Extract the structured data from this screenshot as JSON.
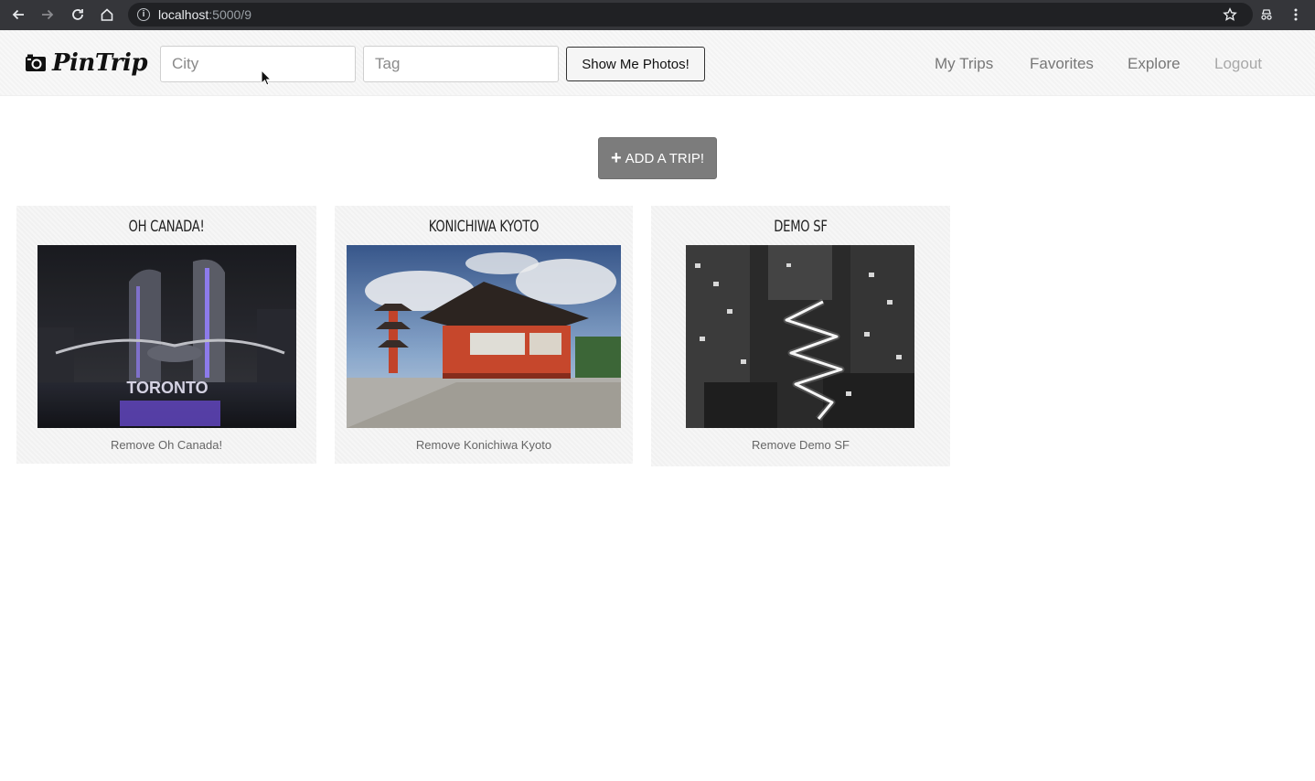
{
  "browser": {
    "url_host": "localhost",
    "url_path": ":5000/9"
  },
  "navbar": {
    "brand": "PinTrip",
    "city_placeholder": "City",
    "tag_placeholder": "Tag",
    "show_button": "Show Me Photos!",
    "links": {
      "my_trips": "My Trips",
      "favorites": "Favorites",
      "explore": "Explore",
      "logout": "Logout"
    }
  },
  "main": {
    "add_trip_label": "ADD A TRIP!",
    "trips": [
      {
        "title": "OH CANADA!",
        "remove": "Remove Oh Canada!",
        "photo_sign": "TORONTO"
      },
      {
        "title": "KONICHIWA KYOTO",
        "remove": "Remove Konichiwa Kyoto"
      },
      {
        "title": "DEMO SF",
        "remove": "Remove Demo SF"
      }
    ]
  },
  "colors": {
    "chrome_dark": "#35363a",
    "navbar_bg": "#f8f8f8",
    "add_button": "#7c7c7c",
    "card_bg": "#f6f6f6"
  }
}
